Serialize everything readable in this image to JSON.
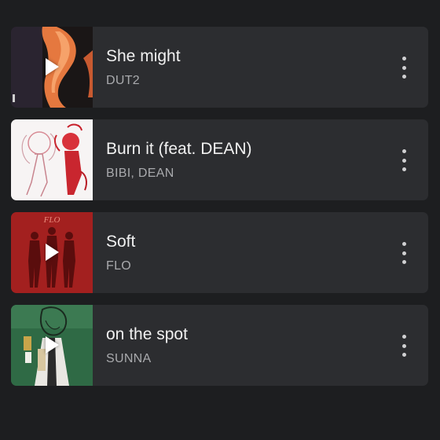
{
  "tracks": [
    {
      "title": "She might",
      "artist": "DUT2",
      "cover": "she-might-cover",
      "playing": true
    },
    {
      "title": "Burn it (feat. DEAN)",
      "artist": "BIBI, DEAN",
      "cover": "burn-it-cover",
      "playing": false
    },
    {
      "title": "Soft",
      "artist": "FLO",
      "cover": "soft-cover",
      "playing": true
    },
    {
      "title": "on the spot",
      "artist": "SUNNA",
      "cover": "on-the-spot-cover",
      "playing": true
    }
  ],
  "icons": {
    "play": "play-icon",
    "more": "more-options-icon"
  },
  "colors": {
    "background": "#1d1e20",
    "card": "#2c2d30",
    "title": "#f1f1f1",
    "artist": "#a9aaad"
  }
}
